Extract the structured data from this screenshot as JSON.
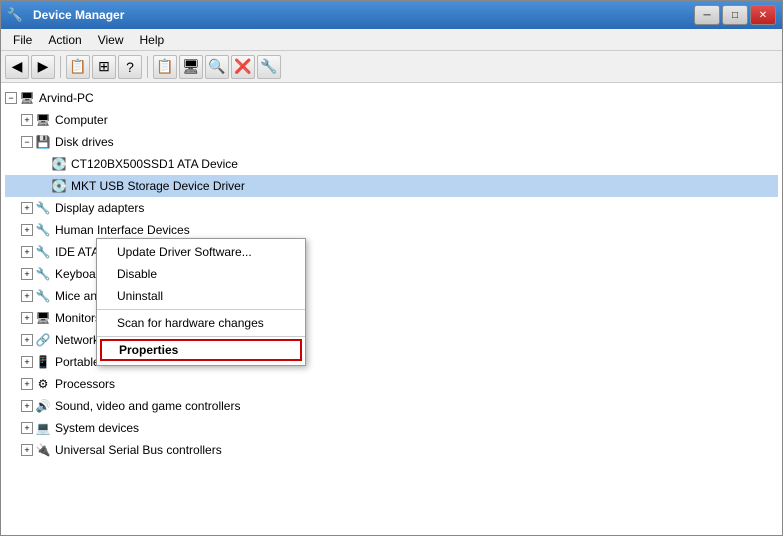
{
  "window": {
    "title": "Device Manager",
    "title_icon": "🔧"
  },
  "title_buttons": {
    "minimize": "─",
    "maximize": "□",
    "close": "✕"
  },
  "menu": {
    "items": [
      "File",
      "Action",
      "View",
      "Help"
    ]
  },
  "toolbar": {
    "buttons": [
      "◀",
      "▶",
      "📋",
      "⊞",
      "?",
      "📋",
      "🖥",
      "🔍",
      "❌",
      "🔧"
    ]
  },
  "tree": {
    "root": "Arvind-PC",
    "items": [
      {
        "label": "Computer",
        "indent": 1,
        "icon": "computer",
        "expandable": true
      },
      {
        "label": "Disk drives",
        "indent": 1,
        "icon": "disk",
        "expandable": true,
        "expanded": true
      },
      {
        "label": "CT120BX500SSD1 ATA Device",
        "indent": 2,
        "icon": "hdd",
        "expandable": false
      },
      {
        "label": "MKT USB Storage Device Driver",
        "indent": 2,
        "icon": "hdd",
        "expandable": false,
        "selected": true
      },
      {
        "label": "Display adapters",
        "indent": 1,
        "icon": "device",
        "expandable": true
      },
      {
        "label": "Human Interface Devices",
        "indent": 1,
        "icon": "device",
        "expandable": true
      },
      {
        "label": "IDE ATA/ATAPI controllers",
        "indent": 1,
        "icon": "device",
        "expandable": true
      },
      {
        "label": "Keyboards",
        "indent": 1,
        "icon": "device",
        "expandable": true
      },
      {
        "label": "Mice and other pointing devices",
        "indent": 1,
        "icon": "device",
        "expandable": true
      },
      {
        "label": "Monitors",
        "indent": 1,
        "icon": "monitor",
        "expandable": true
      },
      {
        "label": "Network adapters",
        "indent": 1,
        "icon": "network",
        "expandable": true
      },
      {
        "label": "Portable Devices",
        "indent": 1,
        "icon": "portable",
        "expandable": true
      },
      {
        "label": "Processors",
        "indent": 1,
        "icon": "cpu",
        "expandable": true
      },
      {
        "label": "Sound, video and game controllers",
        "indent": 1,
        "icon": "sound",
        "expandable": true
      },
      {
        "label": "System devices",
        "indent": 1,
        "icon": "system",
        "expandable": true
      },
      {
        "label": "Universal Serial Bus controllers",
        "indent": 1,
        "icon": "usb",
        "expandable": true
      }
    ]
  },
  "context_menu": {
    "items": [
      {
        "label": "Update Driver Software...",
        "type": "normal"
      },
      {
        "label": "Disable",
        "type": "normal"
      },
      {
        "label": "Uninstall",
        "type": "normal"
      },
      {
        "sep": true
      },
      {
        "label": "Scan for hardware changes",
        "type": "normal"
      },
      {
        "sep": true
      },
      {
        "label": "Properties",
        "type": "highlighted"
      }
    ]
  }
}
